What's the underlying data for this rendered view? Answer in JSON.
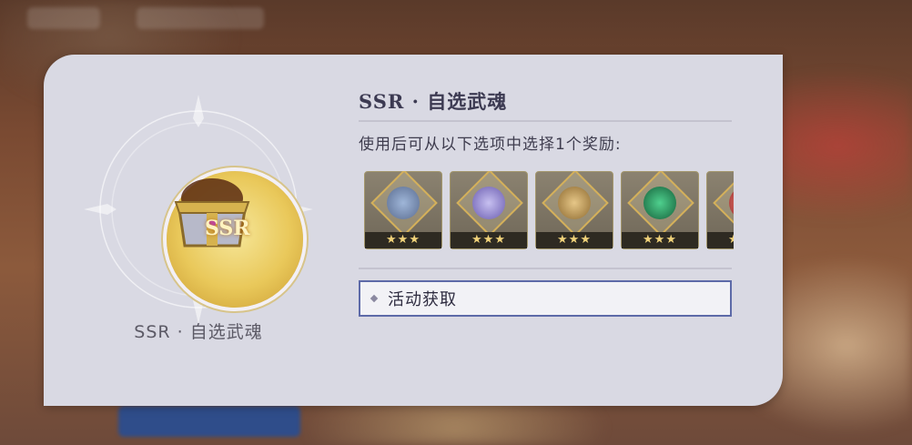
{
  "item": {
    "name": "SSR · 自选武魂",
    "chest_badge": "SSR"
  },
  "details": {
    "title": "SSR · 自选武魂",
    "description": "使用后可从以下选项中选择1个奖励:"
  },
  "options": [
    {
      "name": "weapon-soul-1",
      "stars": "★★★",
      "color": "#9fb6d8"
    },
    {
      "name": "weapon-soul-2",
      "stars": "★★★",
      "color": "#a79ad8"
    },
    {
      "name": "weapon-soul-3",
      "stars": "★★★",
      "color": "#c9a45e"
    },
    {
      "name": "weapon-soul-4",
      "stars": "★★★",
      "color": "#2e9a66"
    },
    {
      "name": "weapon-soul-5",
      "stars": "★★★",
      "color": "#d0605a"
    }
  ],
  "source": {
    "label": "活动获取"
  },
  "colors": {
    "panel_bg": "#d9d9e3",
    "accent_border": "#5d6aa8",
    "star": "#f0d27a"
  }
}
